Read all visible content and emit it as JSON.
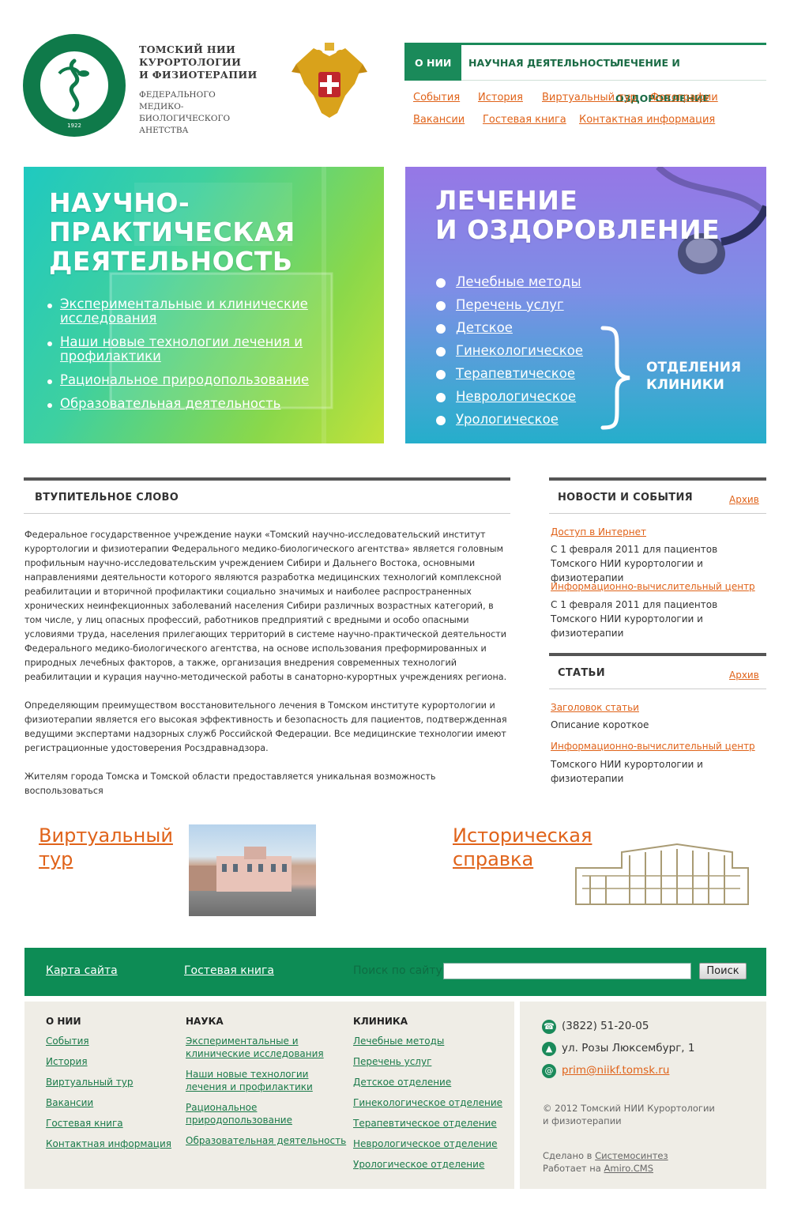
{
  "header": {
    "seal_year": "1922",
    "org_title": [
      "ТОМСКИЙ НИИ",
      "КУРОРТОЛОГИИ",
      "И ФИЗИОТЕРАПИИ"
    ],
    "org_sub": [
      "ФЕДЕРАЛЬНОГО",
      "МЕДИКО-БИОЛОГИЧЕСКОГО",
      "АНЕТСТВА"
    ],
    "emblem_icon": "double-headed-eagle-icon"
  },
  "topnav": {
    "items": [
      "О НИИ",
      "НАУЧНАЯ ДЕЯТЕЛЬНОСТЬ",
      "ЛЕЧЕНИЕ И ОЗДОРОВЛЕНИЕ"
    ],
    "sublinks": [
      "События",
      "История",
      "Виртуальный тур",
      "Фотографии",
      "Вакансии",
      "Гостевая книга",
      "Контактная информация"
    ]
  },
  "banner_left": {
    "heading": [
      "НАУЧНО-",
      "ПРАКТИЧЕСКАЯ",
      "ДЕЯТЕЛЬНОСТЬ"
    ],
    "links": [
      [
        "Экспериментальные и клинические",
        "исследования"
      ],
      [
        "Наши новые технологии лечения и",
        "профилактики"
      ],
      [
        "Рациональное природопользование"
      ],
      [
        "Образовательная деятельность"
      ]
    ]
  },
  "banner_right": {
    "heading": [
      "ЛЕЧЕНИЕ",
      "И ОЗДОРОВЛЕНИЕ"
    ],
    "links": [
      "Лечебные методы",
      "Перечень услуг",
      "Детское",
      "Гинекологическое",
      "Терапевтическое",
      "Неврологическое",
      "Урологическое"
    ],
    "departments_label": [
      "ОТДЕЛЕНИЯ",
      "КЛИНИКИ"
    ]
  },
  "intro": {
    "title": "ВТУПИТЕЛЬНОЕ СЛОВО",
    "paragraphs": [
      "Федеральное государственное учреждение науки «Томский научно-исследовательский институт курортологии и физиотерапии Федерального медико-биологического агентства» является головным профильным научно-исследовательским учреждением Сибири и Дальнего Востока, основными направлениями  деятельности которого являются  разработка медицинских технологий комплексной реабилитации и вторичной профилактики социально значимых и наиболее распространенных хронических неинфекционных  заболеваний населения Сибири различных возрастных категорий, в том числе,  у лиц опасных профессий, работников предприятий с вредными и особо опасными условиями труда, населения прилегающих территорий в системе научно-практической деятельности Федерального медико-биологического агентства, на основе  использования преформированных и природных лечебных факторов, а также, организация внедрения современных технологий реабилитации и курация научно-методической работы в санаторно-курортных учреждениях региона.",
      "Определяющим преимуществом восстановительного лечения в Томском институте курортологии и физиотерапии является его высокая эффективность и безопасность для пациентов, подтвержденная ведущими экспертами надзорных служб Российской Федерации. Все медицинские технологии имеют регистрационные  удостоверения Росздравнадзора.",
      "Жителям города Томска и Томской области предоставляется уникальная возможность воспользоваться"
    ]
  },
  "news": {
    "title": "НОВОСТИ И СОБЫТИЯ",
    "archive": "Архив",
    "items": [
      {
        "title": "Доступ в Интернет",
        "desc": "С 1 февраля 2011 для пациентов Томского НИИ курортологии и физиотерапии"
      },
      {
        "title": "Информационно-вычислительный центр",
        "desc": "С 1 февраля 2011 для пациентов Томского НИИ курортологии и физиотерапии"
      }
    ]
  },
  "articles": {
    "title": "СТАТЬИ",
    "archive": "Архив",
    "items": [
      {
        "title": "Заголовок статьи",
        "desc": "Описание короткое"
      },
      {
        "title": "Информационно-вычислительный центр",
        "desc": "Томского НИИ курортологии и физиотерапии"
      }
    ]
  },
  "promo": {
    "virtual_tour": [
      "Виртуальный",
      "тур"
    ],
    "history": [
      "Историческая",
      "справка"
    ]
  },
  "footer": {
    "bar": {
      "sitemap": "Карта сайта",
      "guestbook": "Гостевая книга",
      "search_label": "Поиск по сайту",
      "search_button": "Поиск"
    },
    "columns": [
      {
        "heading": "О НИИ",
        "links": [
          "События",
          "История",
          "Виртуальный тур",
          "Вакансии",
          "Гостевая книга",
          "Контактная информация"
        ]
      },
      {
        "heading": "НАУКА",
        "links": [
          [
            "Экспериментальные и",
            "клинические исследования"
          ],
          [
            "Наши новые технологии",
            "лечения и профилактики"
          ],
          [
            "Рациональное",
            "природопользование"
          ],
          [
            "Образовательная деятельность"
          ]
        ]
      },
      {
        "heading": "КЛИНИКА",
        "links": [
          "Лечебные методы",
          "Перечень услуг",
          "Детское отделение",
          "Гинекологическое отделение",
          "Терапевтическое отделение",
          "Неврологическое отделение",
          "Урологическое отделение"
        ]
      }
    ],
    "phone": "(3822) 51-20-05",
    "address": "ул. Розы Люксембург, 1",
    "email": "prim@niikf.tomsk.ru",
    "copyright": [
      "© 2012  Томский НИИ Курортологии",
      "и физиотерапии"
    ],
    "made_in_prefix": "Сделано в ",
    "made_in_link": "Системосинтез",
    "powered_prefix": "Работает на ",
    "powered_link": "Amiro.CMS",
    "accent_color": "#0d8c55"
  }
}
